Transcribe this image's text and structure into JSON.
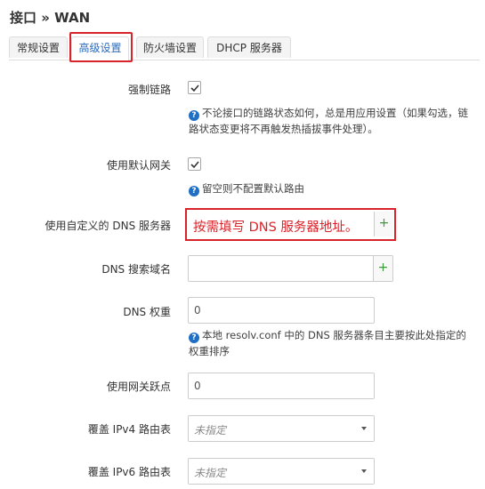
{
  "title": "接口 » WAN",
  "tabs": [
    "常规设置",
    "高级设置",
    "防火墙设置",
    "DHCP 服务器"
  ],
  "fields": {
    "force_link": {
      "label": "强制链路",
      "checked": true,
      "help": "不论接口的链路状态如何，总是用应用设置（如果勾选，链路状态变更将不再触发热插拔事件处理）。"
    },
    "default_gw": {
      "label": "使用默认网关",
      "checked": true,
      "help": "留空则不配置默认路由"
    },
    "custom_dns": {
      "label": "使用自定义的 DNS 服务器",
      "annotation": "按需填写 DNS 服务器地址。"
    },
    "dns_search": {
      "label": "DNS 搜索域名",
      "value": ""
    },
    "dns_weight": {
      "label": "DNS 权重",
      "value": "0",
      "help": "本地 resolv.conf 中的 DNS 服务器条目主要按此处指定的权重排序"
    },
    "gw_metric": {
      "label": "使用网关跃点",
      "value": "0"
    },
    "ipv4_table": {
      "label": "覆盖 IPv4 路由表",
      "value": "未指定"
    },
    "ipv6_table": {
      "label": "覆盖 IPv6 路由表",
      "value": "未指定"
    }
  },
  "icons": {
    "help": "help-icon",
    "add": "plus-icon",
    "checkbox": "checkmark-icon"
  },
  "colors": {
    "accent": "#2a6bbf",
    "highlight": "#d9232a",
    "add_button": "#3a9a3a"
  }
}
